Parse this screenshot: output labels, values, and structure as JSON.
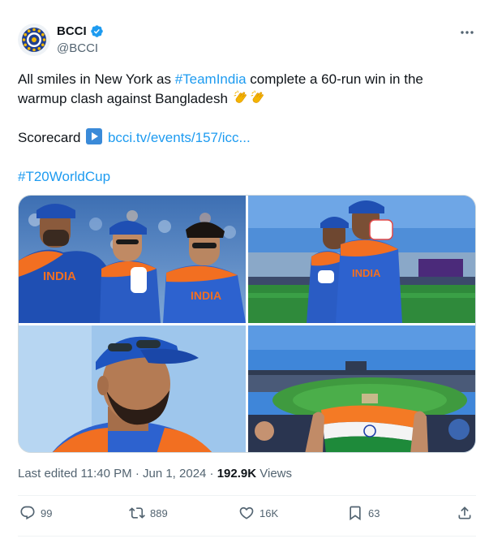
{
  "author": {
    "display_name": "BCCI",
    "handle": "@BCCI",
    "verified": true,
    "accent": "#1d9bf0"
  },
  "tweet": {
    "text_a": "All smiles in New York as ",
    "hashtag_team": "#TeamIndia",
    "text_b": " complete a 60-run win in the",
    "text_c": "warmup clash against Bangladesh ",
    "scorecard_label": "Scorecard ",
    "scorecard_link": "bcci.tv/events/157/icc...",
    "hashtag_wc": "#T20WorldCup",
    "emojis": [
      "clapping-hands",
      "clapping-hands"
    ]
  },
  "media": {
    "photos": [
      {
        "name": "players-smiling-photo",
        "jersey_text": "INDIA"
      },
      {
        "name": "players-walking-photo",
        "jersey_text": "INDIA"
      },
      {
        "name": "captain-closeup-photo"
      },
      {
        "name": "stadium-flag-photo"
      }
    ]
  },
  "meta": {
    "edited": "Last edited 11:40 PM · Jun 1, 2024 · ",
    "views_count": "192.9K",
    "views_label": " Views"
  },
  "actions": {
    "replies": "99",
    "retweets": "889",
    "likes": "16K",
    "bookmarks": "63"
  }
}
